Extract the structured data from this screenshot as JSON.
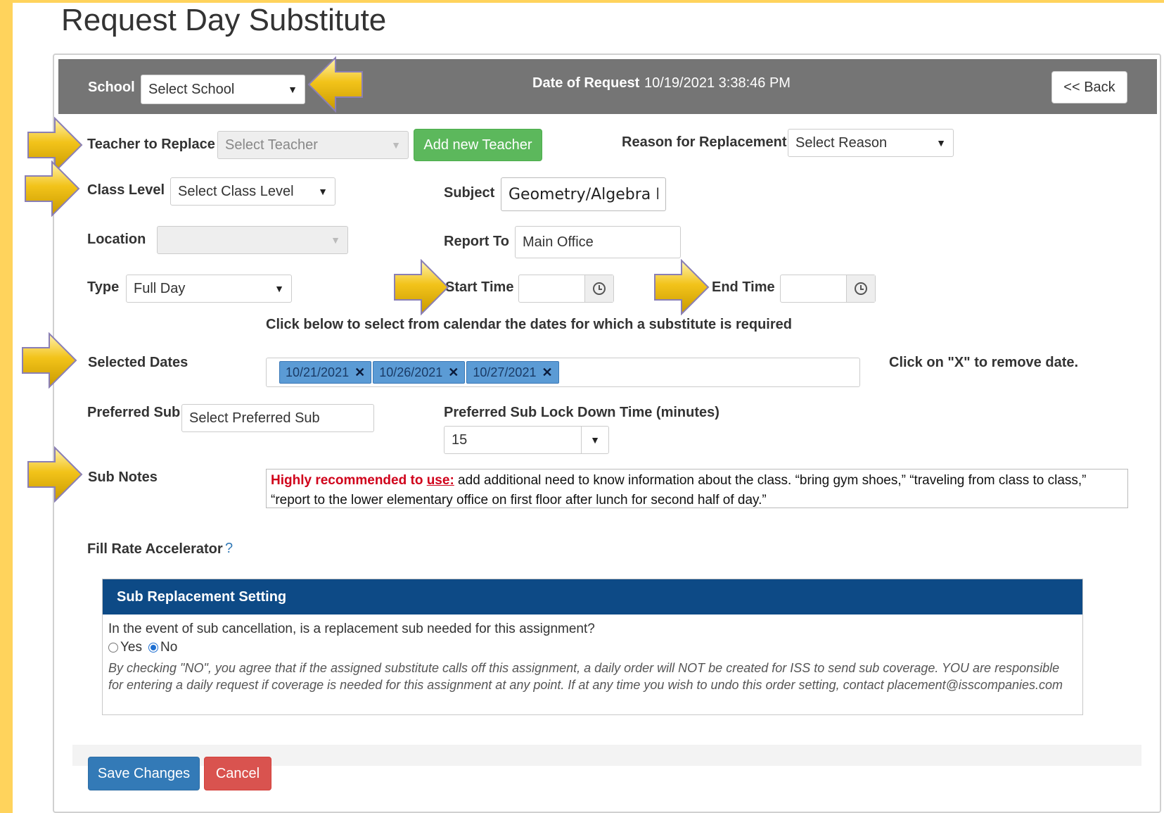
{
  "page": {
    "title": "Request Day Substitute"
  },
  "header": {
    "school_label": "School",
    "school_select": "Select School",
    "date_label": "Date of Request",
    "date_value": "10/19/2021 3:38:46 PM",
    "back_button": "<< Back"
  },
  "form": {
    "teacher_label": "Teacher to Replace",
    "teacher_select": "Select Teacher",
    "add_teacher_button": "Add new Teacher",
    "reason_label": "Reason for Replacement",
    "reason_select": "Select Reason",
    "class_level_label": "Class Level",
    "class_level_select": "Select Class Level",
    "subject_label": "Subject",
    "subject_value": "Geometry/Algebra I",
    "location_label": "Location",
    "location_select": "",
    "report_to_label": "Report To",
    "report_to_value": "Main Office",
    "type_label": "Type",
    "type_select": "Full Day",
    "start_time_label": "Start Time",
    "start_time_value": "",
    "end_time_label": "End Time",
    "end_time_value": "",
    "calendar_instruction": "Click below to select from calendar the dates for which a substitute is required",
    "selected_dates_label": "Selected Dates",
    "selected_dates": [
      "10/21/2021",
      "10/26/2021",
      "10/27/2021"
    ],
    "remove_hint": "Click on \"X\" to remove date.",
    "preferred_sub_label": "Preferred Sub",
    "preferred_sub_select": "Select Preferred Sub",
    "lockdown_label": "Preferred Sub Lock Down Time (minutes)",
    "lockdown_value": "15",
    "sub_notes_label": "Sub Notes",
    "sub_notes_highlight": "Highly recommended to ",
    "sub_notes_highlight_use": "use:",
    "sub_notes_text": " add additional need to know information about the class. “bring gym shoes,” “traveling from class to class,” “report to the lower elementary office on first floor after lunch for second half of day.”",
    "fill_rate_label": "Fill Rate Accelerator",
    "fill_rate_help": "?"
  },
  "sub_replacement": {
    "title": "Sub Replacement Setting",
    "question": "In the event of sub cancellation, is a replacement sub needed for this assignment?",
    "yes_label": "Yes",
    "no_label": "No",
    "selected": "No",
    "note": "By checking \"NO\", you agree that if the assigned substitute calls off this assignment, a daily order will NOT be created for ISS to send sub coverage. YOU are responsible for entering a daily request if coverage is needed for this assignment at any point. If at any time you wish to undo this order setting, contact placement@isscompanies.com"
  },
  "actions": {
    "save": "Save Changes",
    "cancel": "Cancel"
  },
  "colors": {
    "border_yellow": "#ffd35c",
    "header_gray": "#757575",
    "panel_blue": "#0d4a86",
    "green": "#5cb85c",
    "blue": "#337ab7",
    "red": "#d9534f",
    "arrow_gold": "#f2c31a"
  },
  "icons": {
    "select_caret": "chevron-down-icon",
    "time": "clock-icon",
    "remove_date": "close-icon",
    "annotation": "arrow-icon"
  }
}
